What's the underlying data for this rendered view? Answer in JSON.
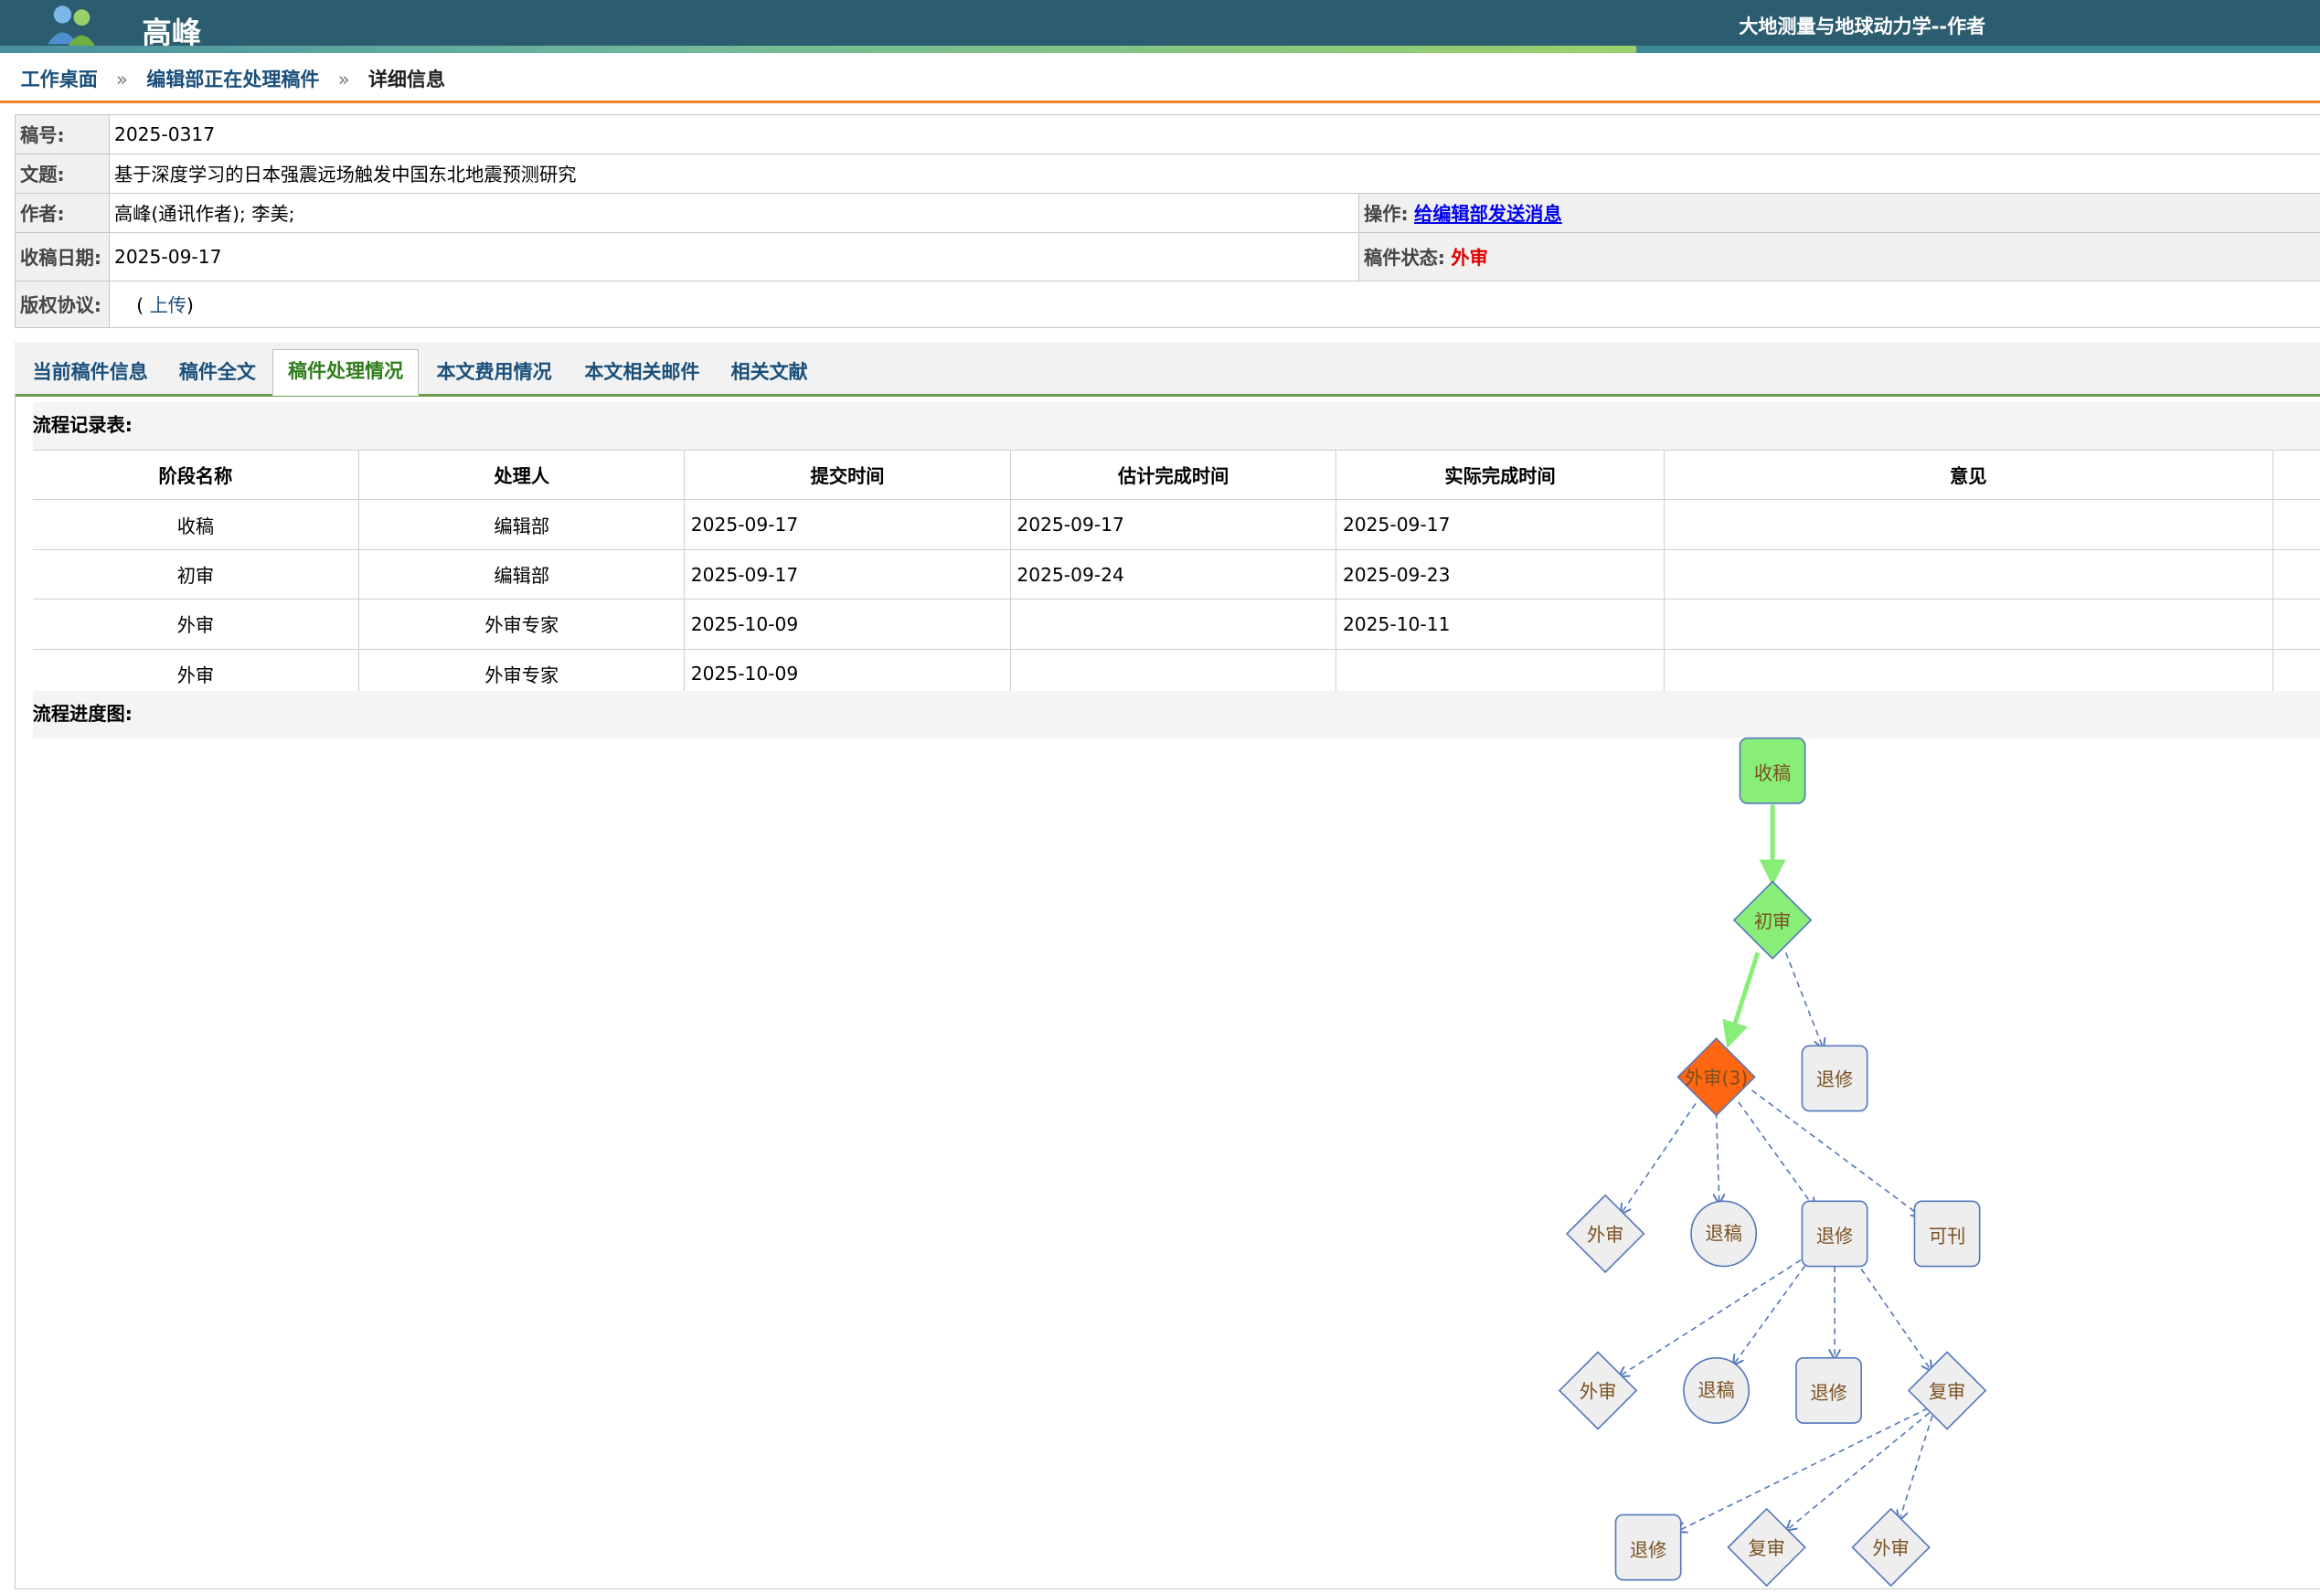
{
  "header": {
    "username": "高峰",
    "journal": "大地测量与地球动力学--作者"
  },
  "breadcrumb": {
    "home": "工作桌面",
    "list": "编辑部正在处理稿件",
    "current": "详细信息",
    "separator": "»"
  },
  "manuscript": {
    "id_label": "稿号:",
    "id": "2025-0317",
    "title_label": "文题:",
    "title": "基于深度学习的日本强震远场触发中国东北地震预测研究",
    "author_label": "作者:",
    "authors": "高峰(通讯作者); 李美;",
    "action_label": "操作:",
    "action_link": "给编辑部发送消息",
    "date_label": "收稿日期:",
    "received": "2025-09-17",
    "status_label": "稿件状态:",
    "status": "外审",
    "copyright_label": "版权协议:",
    "copyright_prefix": "(",
    "copyright_upload": "上传",
    "copyright_suffix": ")"
  },
  "tabs": [
    {
      "label": "当前稿件信息"
    },
    {
      "label": "稿件全文"
    },
    {
      "label": "稿件处理情况"
    },
    {
      "label": "本文费用情况"
    },
    {
      "label": "本文相关邮件"
    },
    {
      "label": "相关文献"
    }
  ],
  "active_tab": "稿件处理情况",
  "flow_table": {
    "title": "流程记录表:",
    "columns": [
      "阶段名称",
      "处理人",
      "提交时间",
      "估计完成时间",
      "实际完成时间",
      "意见"
    ],
    "rows": [
      [
        "收稿",
        "编辑部",
        "2025-09-17",
        "2025-09-17",
        "2025-09-17",
        ""
      ],
      [
        "初审",
        "编辑部",
        "2025-09-17",
        "2025-09-24",
        "2025-09-23",
        ""
      ],
      [
        "外审",
        "外审专家",
        "2025-10-09",
        "",
        "2025-10-11",
        ""
      ],
      [
        "外审",
        "外审专家",
        "2025-10-09",
        "",
        "",
        ""
      ]
    ]
  },
  "flow_chart": {
    "title": "流程进度图:",
    "nodes": {
      "receive": "收稿",
      "initial": "初审",
      "external_current": "外审(3)",
      "revise_a": "退修",
      "external_b": "外审",
      "reject_b": "退稿",
      "revise_b": "退修",
      "publishable": "可刊",
      "external_c": "外审",
      "reject_c": "退稿",
      "revise_c": "退修",
      "recheck_c": "复审",
      "revise_d": "退修",
      "recheck_d": "复审",
      "external_d": "外审"
    },
    "colors": {
      "done": "#88ee77",
      "current": "#ff6611",
      "pending": "#eeeeee",
      "pending_border": "#5577bb",
      "path_done": "#88ee77",
      "node_text_pending": "#7a5020"
    }
  }
}
